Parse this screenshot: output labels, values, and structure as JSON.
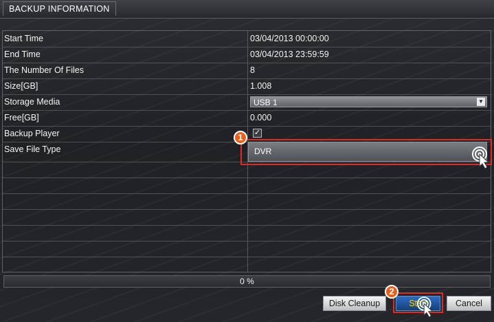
{
  "window": {
    "title": "BACKUP INFORMATION"
  },
  "rows": [
    {
      "label": "Start Time",
      "value": "03/04/2013 00:00:00"
    },
    {
      "label": "End Time",
      "value": "03/04/2013 23:59:59"
    },
    {
      "label": "The Number Of Files",
      "value": "8"
    },
    {
      "label": "Size[GB]",
      "value": "1.008"
    },
    {
      "label": "Storage Media",
      "value": "USB 1"
    },
    {
      "label": "Free[GB]",
      "value": "0.000"
    },
    {
      "label": "Backup Player",
      "value": "✓"
    },
    {
      "label": "Save File Type",
      "value": "DVR"
    }
  ],
  "progress": {
    "text": "0 %",
    "value": 0
  },
  "buttons": {
    "disk_cleanup": "Disk Cleanup",
    "start": "Start",
    "cancel": "Cancel"
  },
  "annotations": {
    "step1": "1",
    "step2": "2"
  },
  "colors": {
    "highlight": "#e02a2a",
    "badge": "#e8601c",
    "start_text": "#ffd400"
  },
  "icons": {
    "dropdown": "chevron-down-icon",
    "cursor": "hand-pointer-icon"
  }
}
